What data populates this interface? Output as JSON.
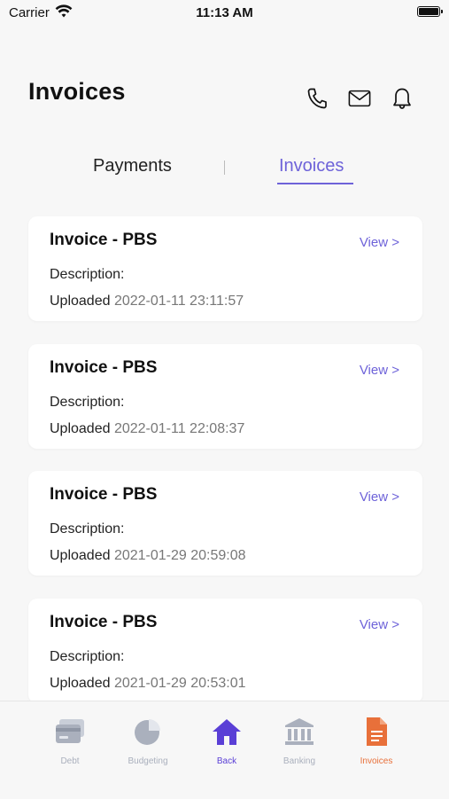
{
  "status_bar": {
    "carrier": "Carrier",
    "time": "11:13 AM"
  },
  "header": {
    "title": "Invoices"
  },
  "tabs": [
    {
      "label": "Payments",
      "active": false
    },
    {
      "label": "Invoices",
      "active": true
    }
  ],
  "invoices": [
    {
      "title": "Invoice - PBS",
      "view_label": "View >",
      "description_label": "Description:",
      "uploaded_label": "Uploaded",
      "date": "2022-01-11 23:11:57"
    },
    {
      "title": "Invoice - PBS",
      "view_label": "View >",
      "description_label": "Description:",
      "uploaded_label": "Uploaded",
      "date": "2022-01-11 22:08:37"
    },
    {
      "title": "Invoice - PBS",
      "view_label": "View >",
      "description_label": "Description:",
      "uploaded_label": "Uploaded",
      "date": "2021-01-29 20:59:08"
    },
    {
      "title": "Invoice - PBS",
      "view_label": "View >",
      "description_label": "Description:",
      "uploaded_label": "Uploaded",
      "date": "2021-01-29 20:53:01"
    }
  ],
  "bottom_nav": [
    {
      "label": "Debt",
      "icon": "credit-card-icon"
    },
    {
      "label": "Budgeting",
      "icon": "pie-chart-icon"
    },
    {
      "label": "Back",
      "icon": "home-icon"
    },
    {
      "label": "Banking",
      "icon": "bank-icon"
    },
    {
      "label": "Invoices",
      "icon": "document-icon"
    }
  ],
  "colors": {
    "accent": "#6e63d9",
    "nav_active_home": "#5a3fd6",
    "nav_active_invoices": "#e8703a",
    "nav_inactive": "#aab0bd"
  }
}
